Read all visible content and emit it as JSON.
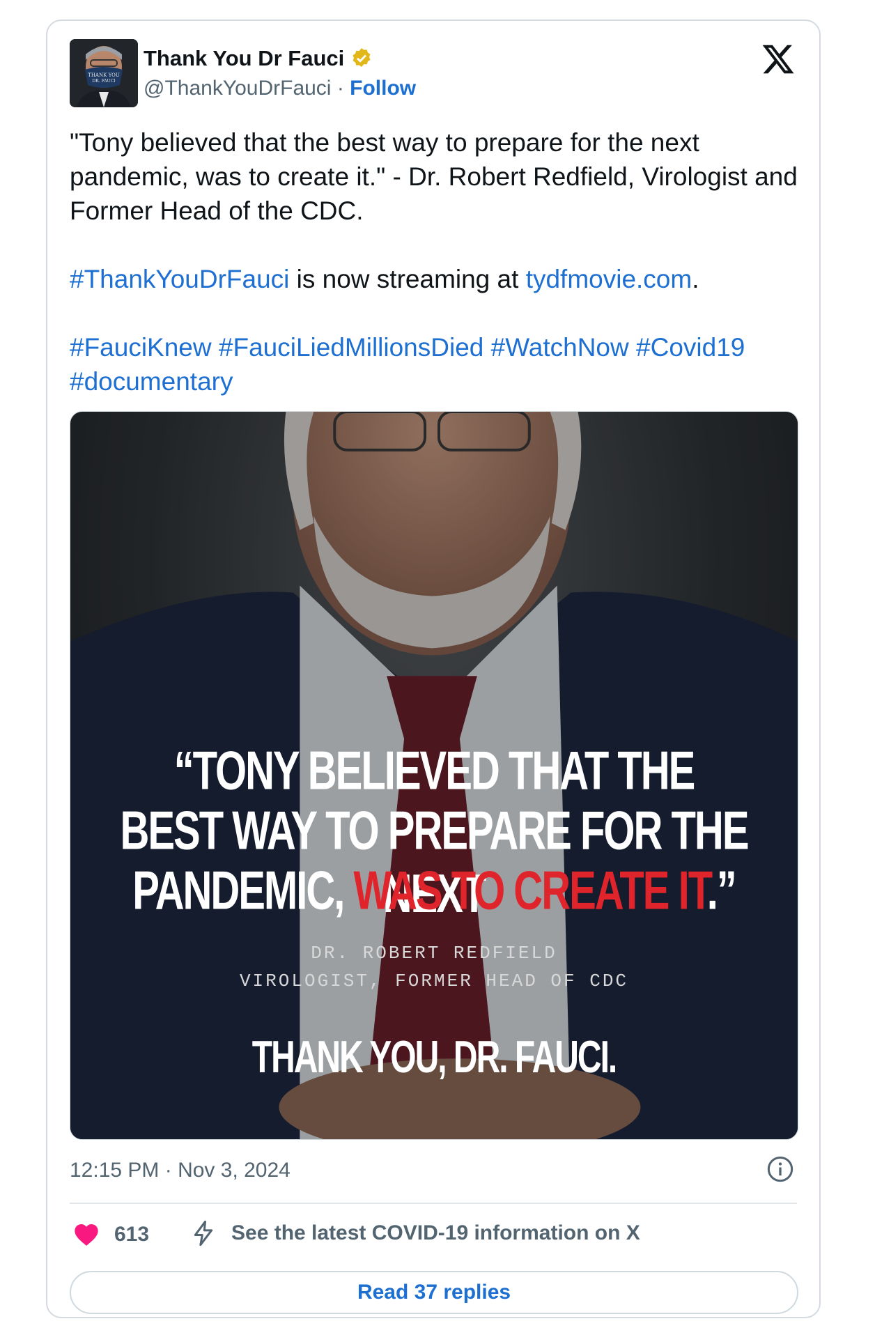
{
  "header": {
    "display_name": "Thank You Dr Fauci",
    "handle": "@ThankYouDrFauci",
    "separator": " · ",
    "follow_label": "Follow",
    "avatar_mask_text": "THANK YOU DR. FAUCI"
  },
  "tweet": {
    "quote": "\"Tony believed that the best way to prepare for the next pandemic, was to create it.\" - Dr. Robert Redfield, Virologist and Former Head of the CDC.",
    "line2_hashtag": "#ThankYouDrFauci",
    "line2_middle": " is now streaming at ",
    "line2_link": "tydfmovie.com",
    "line2_end": ".",
    "hashtags": [
      "#FauciKnew",
      "#FauciLiedMillionsDied",
      "#WatchNow",
      "#Covid19",
      "#documentary"
    ]
  },
  "media": {
    "quote_line1": "“TONY BELIEVED THAT THE",
    "quote_line2": "BEST WAY TO PREPARE FOR THE NEXT",
    "quote_line3_white": "PANDEMIC, ",
    "quote_line3_red": "WAS TO CREATE IT",
    "quote_line3_end": ".”",
    "attribution_name": "DR. ROBERT REDFIELD",
    "attribution_title": "VIROLOGIST, FORMER HEAD OF CDC",
    "title": "THANK YOU, DR. FAUCI."
  },
  "meta": {
    "timestamp": "12:15 PM · Nov 3, 2024"
  },
  "actions": {
    "like_count": "613",
    "covid_info": "See the latest COVID-19 information on X",
    "read_replies": "Read 37 replies"
  },
  "colors": {
    "link": "#1d6fd2",
    "heart": "#f91880",
    "muted": "#536471",
    "accent_red": "#e0242b",
    "verified_gold": "#e2b719"
  },
  "icons": [
    "verified-badge-icon",
    "x-logo-icon",
    "info-icon",
    "heart-icon",
    "lightning-icon"
  ]
}
